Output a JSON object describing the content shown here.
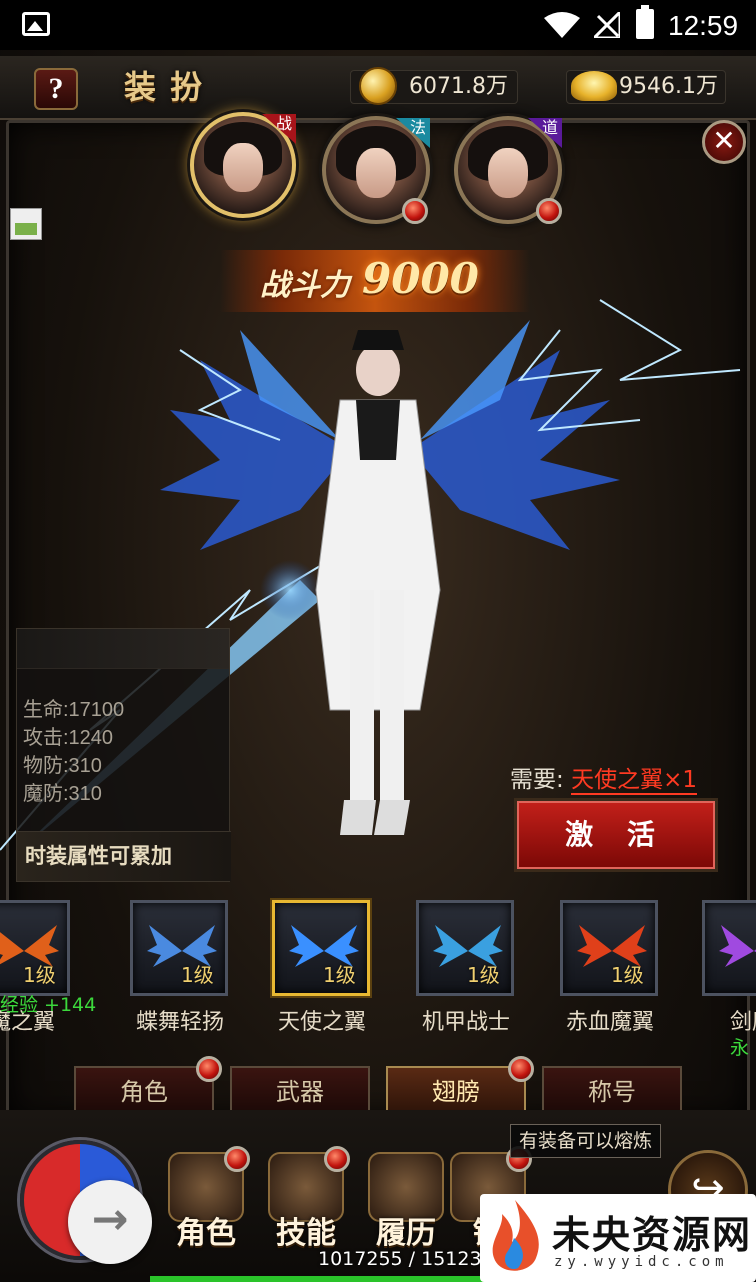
{
  "status_bar": {
    "time": "12:59"
  },
  "header": {
    "help_label": "?",
    "title": "装扮",
    "gold_amount": "6071.8万",
    "ingot_amount": "9546.1万",
    "close_label": "✕"
  },
  "characters": [
    {
      "class_tag": "战",
      "selected": true
    },
    {
      "class_tag": "法",
      "selected": false
    },
    {
      "class_tag": "道",
      "selected": false
    }
  ],
  "power": {
    "label": "战斗力",
    "value": "9000"
  },
  "stats": {
    "lines": [
      "生命:17100",
      "攻击:1240",
      "物防:310",
      "魔防:310"
    ],
    "footer": "时装属性可累加"
  },
  "requirement": {
    "label": "需要:",
    "item": "天使之翼×1"
  },
  "activate_label": "激 活",
  "wings": [
    {
      "name": "魔之翼",
      "level": "1级",
      "color": "#e0601a",
      "selected": false
    },
    {
      "name": "蝶舞轻扬",
      "level": "1级",
      "color": "#4a8ae0",
      "selected": false
    },
    {
      "name": "天使之翼",
      "level": "1级",
      "color": "#3a90ff",
      "selected": true
    },
    {
      "name": "机甲战士",
      "level": "1级",
      "color": "#3aa0e0",
      "selected": false
    },
    {
      "name": "赤血魔翼",
      "level": "1级",
      "color": "#e0401a",
      "selected": false
    },
    {
      "name": "剑魔",
      "level": "",
      "color": "#a04ae0",
      "selected": false
    }
  ],
  "exp_gain": "经验 +144",
  "clipped_green": "永",
  "tabs": [
    {
      "label": "角色",
      "active": false
    },
    {
      "label": "武器",
      "active": false
    },
    {
      "label": "翅膀",
      "active": true
    },
    {
      "label": "称号",
      "active": false
    }
  ],
  "smelt_tip": "有装备可以熔炼",
  "hud_buttons": [
    {
      "label": "角色",
      "icon": "helmet-icon"
    },
    {
      "label": "技能",
      "icon": "skill-book-icon"
    },
    {
      "label": "履历",
      "icon": "scroll-icon"
    },
    {
      "label": "锻",
      "icon": "anvil-icon"
    }
  ],
  "experience": {
    "text": "1017255 / 1512382",
    "progress": 0.673
  },
  "watermark": {
    "title": "未央资源网",
    "url": "zy.wyyidc.com"
  },
  "colors": {
    "accent_gold": "#e2c06a",
    "alert_red": "#ff3a22",
    "exp_green": "#3cd83c"
  }
}
